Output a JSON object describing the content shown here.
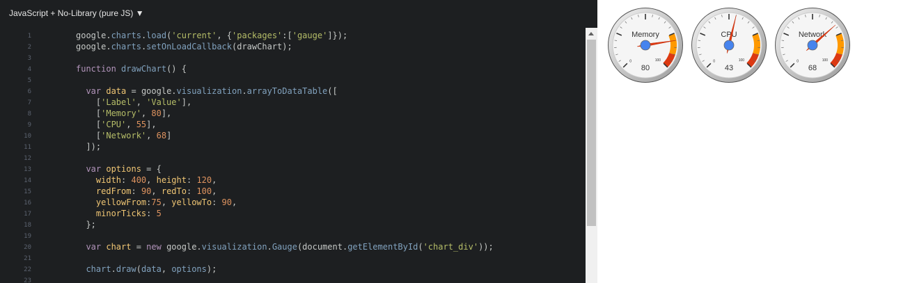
{
  "editor": {
    "language_label": "JavaScript + No-Library (pure JS) ▼",
    "lines": [
      {
        "n": "1",
        "tokens": [
          [
            "plain",
            "google."
          ],
          [
            "fn",
            "charts"
          ],
          [
            "plain",
            "."
          ],
          [
            "fn",
            "load"
          ],
          [
            "plain",
            "("
          ],
          [
            "str",
            "'current'"
          ],
          [
            "plain",
            ", {"
          ],
          [
            "str",
            "'packages'"
          ],
          [
            "plain",
            ":["
          ],
          [
            "str",
            "'gauge'"
          ],
          [
            "plain",
            "]});"
          ]
        ]
      },
      {
        "n": "2",
        "tokens": [
          [
            "plain",
            "google."
          ],
          [
            "fn",
            "charts"
          ],
          [
            "plain",
            "."
          ],
          [
            "fn",
            "setOnLoadCallback"
          ],
          [
            "plain",
            "(drawChart);"
          ]
        ]
      },
      {
        "n": "3",
        "tokens": []
      },
      {
        "n": "4",
        "tokens": [
          [
            "kw",
            "function "
          ],
          [
            "fn",
            "drawChart"
          ],
          [
            "plain",
            "() {"
          ]
        ]
      },
      {
        "n": "5",
        "tokens": []
      },
      {
        "n": "6",
        "tokens": [
          [
            "plain",
            "  "
          ],
          [
            "kw",
            "var "
          ],
          [
            "prop",
            "data"
          ],
          [
            "plain",
            " = google."
          ],
          [
            "fn",
            "visualization"
          ],
          [
            "plain",
            "."
          ],
          [
            "fn",
            "arrayToDataTable"
          ],
          [
            "plain",
            "(["
          ]
        ]
      },
      {
        "n": "7",
        "tokens": [
          [
            "plain",
            "    ["
          ],
          [
            "str",
            "'Label'"
          ],
          [
            "plain",
            ", "
          ],
          [
            "str",
            "'Value'"
          ],
          [
            "plain",
            "],"
          ]
        ]
      },
      {
        "n": "8",
        "tokens": [
          [
            "plain",
            "    ["
          ],
          [
            "str",
            "'Memory'"
          ],
          [
            "plain",
            ", "
          ],
          [
            "num",
            "80"
          ],
          [
            "plain",
            "],"
          ]
        ]
      },
      {
        "n": "9",
        "tokens": [
          [
            "plain",
            "    ["
          ],
          [
            "str",
            "'CPU'"
          ],
          [
            "plain",
            ", "
          ],
          [
            "num",
            "55"
          ],
          [
            "plain",
            "],"
          ]
        ]
      },
      {
        "n": "10",
        "tokens": [
          [
            "plain",
            "    ["
          ],
          [
            "str",
            "'Network'"
          ],
          [
            "plain",
            ", "
          ],
          [
            "num",
            "68"
          ],
          [
            "plain",
            "]"
          ]
        ]
      },
      {
        "n": "11",
        "tokens": [
          [
            "plain",
            "  ]);"
          ]
        ]
      },
      {
        "n": "12",
        "tokens": []
      },
      {
        "n": "13",
        "tokens": [
          [
            "plain",
            "  "
          ],
          [
            "kw",
            "var "
          ],
          [
            "prop",
            "options"
          ],
          [
            "plain",
            " = {"
          ]
        ]
      },
      {
        "n": "14",
        "tokens": [
          [
            "plain",
            "    "
          ],
          [
            "prop",
            "width"
          ],
          [
            "plain",
            ": "
          ],
          [
            "num",
            "400"
          ],
          [
            "plain",
            ", "
          ],
          [
            "prop",
            "height"
          ],
          [
            "plain",
            ": "
          ],
          [
            "num",
            "120"
          ],
          [
            "plain",
            ","
          ]
        ]
      },
      {
        "n": "15",
        "tokens": [
          [
            "plain",
            "    "
          ],
          [
            "prop",
            "redFrom"
          ],
          [
            "plain",
            ": "
          ],
          [
            "num",
            "90"
          ],
          [
            "plain",
            ", "
          ],
          [
            "prop",
            "redTo"
          ],
          [
            "plain",
            ": "
          ],
          [
            "num",
            "100"
          ],
          [
            "plain",
            ","
          ]
        ]
      },
      {
        "n": "16",
        "tokens": [
          [
            "plain",
            "    "
          ],
          [
            "prop",
            "yellowFrom"
          ],
          [
            "plain",
            ":"
          ],
          [
            "num",
            "75"
          ],
          [
            "plain",
            ", "
          ],
          [
            "prop",
            "yellowTo"
          ],
          [
            "plain",
            ": "
          ],
          [
            "num",
            "90"
          ],
          [
            "plain",
            ","
          ]
        ]
      },
      {
        "n": "17",
        "tokens": [
          [
            "plain",
            "    "
          ],
          [
            "prop",
            "minorTicks"
          ],
          [
            "plain",
            ": "
          ],
          [
            "num",
            "5"
          ]
        ]
      },
      {
        "n": "18",
        "tokens": [
          [
            "plain",
            "  };"
          ]
        ]
      },
      {
        "n": "19",
        "tokens": []
      },
      {
        "n": "20",
        "tokens": [
          [
            "plain",
            "  "
          ],
          [
            "kw",
            "var "
          ],
          [
            "prop",
            "chart"
          ],
          [
            "plain",
            " = "
          ],
          [
            "kw",
            "new "
          ],
          [
            "plain",
            "google."
          ],
          [
            "fn",
            "visualization"
          ],
          [
            "plain",
            "."
          ],
          [
            "fn",
            "Gauge"
          ],
          [
            "plain",
            "(document."
          ],
          [
            "fn",
            "getElementById"
          ],
          [
            "plain",
            "("
          ],
          [
            "str",
            "'chart_div'"
          ],
          [
            "plain",
            "));"
          ]
        ]
      },
      {
        "n": "21",
        "tokens": []
      },
      {
        "n": "22",
        "tokens": [
          [
            "plain",
            "  "
          ],
          [
            "fn",
            "chart"
          ],
          [
            "plain",
            "."
          ],
          [
            "fn",
            "draw"
          ],
          [
            "plain",
            "("
          ],
          [
            "fn",
            "data"
          ],
          [
            "plain",
            ", "
          ],
          [
            "fn",
            "options"
          ],
          [
            "plain",
            ");"
          ]
        ]
      },
      {
        "n": "23",
        "tokens": []
      }
    ]
  },
  "colors": {
    "editor_bg": "#1d1f21",
    "keyword": "#b294bb",
    "function": "#81a2be",
    "string": "#b5bd68",
    "number": "#de935f",
    "property": "#f0c674",
    "plain": "#c5c8c6",
    "gauge_yellow": "#ff9900",
    "gauge_red": "#dc3912",
    "needle": "#dc3912",
    "hub": "#4684ee"
  },
  "gauges": [
    {
      "label": "Memory",
      "value": 80,
      "value_text": "80"
    },
    {
      "label": "CPU",
      "value": 55,
      "value_text": "43"
    },
    {
      "label": "Network",
      "value": 68,
      "value_text": "68"
    }
  ],
  "gauge_scale": {
    "min": 0,
    "max": 100,
    "min_label": "0",
    "max_label": "100",
    "yellowFrom": 75,
    "yellowTo": 90,
    "redFrom": 90,
    "redTo": 100,
    "minorTicks": 5
  }
}
